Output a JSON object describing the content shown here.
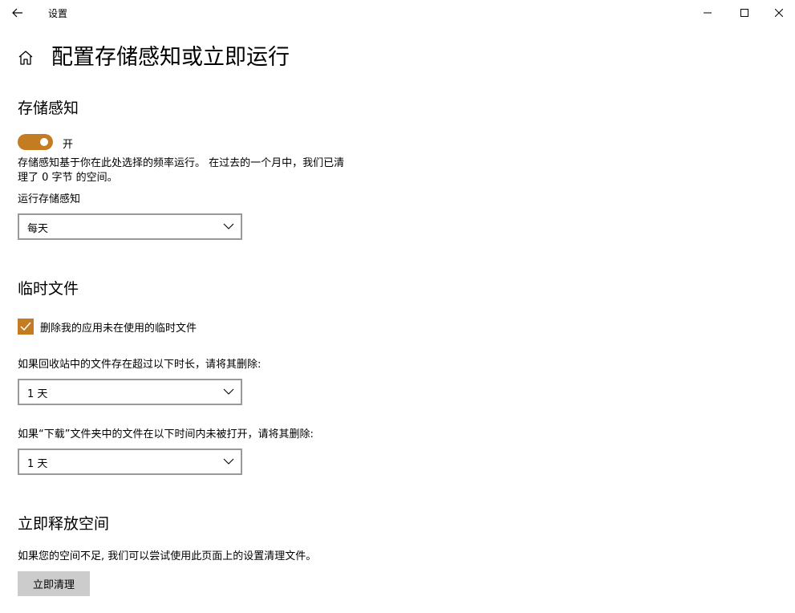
{
  "window": {
    "app_title": "设置"
  },
  "page": {
    "title": "配置存储感知或立即运行"
  },
  "storage_sense": {
    "heading": "存储感知",
    "toggle_state": "开",
    "toggle_on": true,
    "description_line1": "存储感知基于你在此处选择的频率运行。 在过去的一个月中，我们已清",
    "description_line2": "理了 0 字节 的空间。",
    "run_label": "运行存储感知",
    "run_value": "每天"
  },
  "temp_files": {
    "heading": "临时文件",
    "checkbox_label": "删除我的应用未在使用的临时文件",
    "checkbox_checked": true,
    "recycle_label": "如果回收站中的文件存在超过以下时长，请将其删除:",
    "recycle_value": "1 天",
    "downloads_label": "如果“下载”文件夹中的文件在以下时间内未被打开，请将其删除:",
    "downloads_value": "1 天"
  },
  "free_space": {
    "heading": "立即释放空间",
    "description": "如果您的空间不足, 我们可以尝试使用此页面上的设置清理文件。",
    "button_label": "立即清理"
  },
  "colors": {
    "accent": "#c47c23",
    "button_bg": "#cccccc",
    "dropdown_border": "#999999"
  },
  "icons": {
    "back": "arrow-left",
    "home": "house-outline",
    "minimize": "dash",
    "maximize": "square",
    "close": "x",
    "chevron": "chevron-down",
    "check": "checkmark"
  }
}
